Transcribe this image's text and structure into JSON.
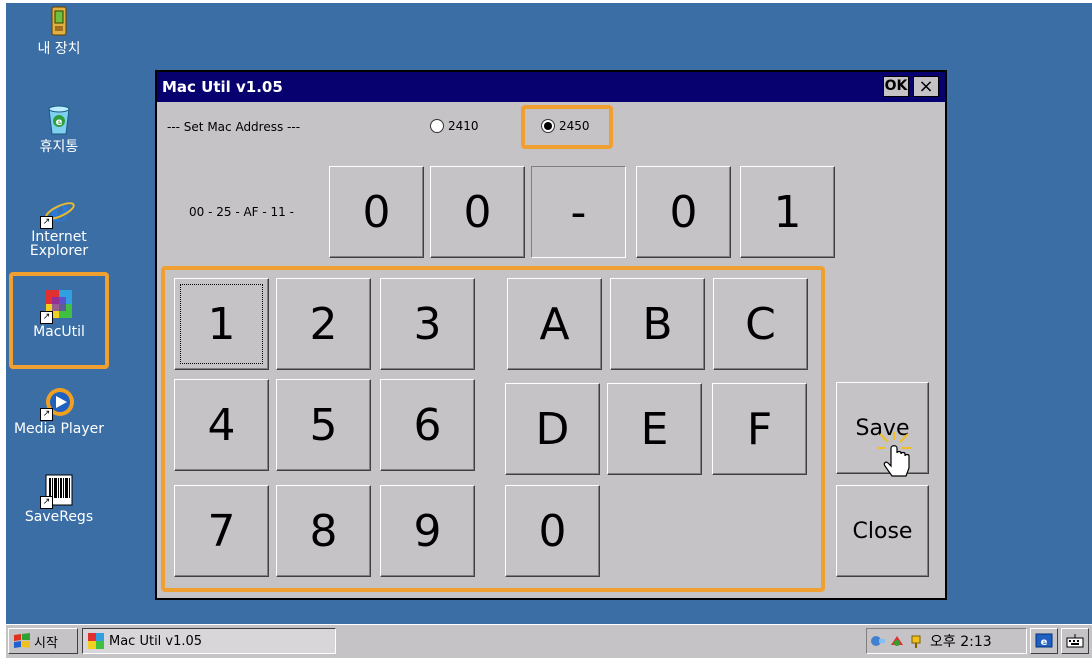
{
  "desktop": {
    "icons": [
      {
        "label": "내 장치"
      },
      {
        "label": "휴지통"
      },
      {
        "label": "Internet Explorer"
      },
      {
        "label": "MacUtil"
      },
      {
        "label": "Media Player"
      },
      {
        "label": "SaveRegs"
      }
    ]
  },
  "window": {
    "title": "Mac Util v1.05",
    "ok_label": "OK",
    "close_label": "×",
    "section_label": "--- Set Mac Address ---",
    "radio_2410": "2410",
    "radio_2450": "2450",
    "selected_band": "2450",
    "mac_prefix": "00 - 25 - AF - 11 -",
    "mac_digits": [
      "0",
      "0",
      "-",
      "0",
      "1"
    ],
    "keypad": {
      "row1": [
        "1",
        "2",
        "3",
        "A",
        "B",
        "C"
      ],
      "row2": [
        "4",
        "5",
        "6",
        "D",
        "E",
        "F"
      ],
      "row3": [
        "7",
        "8",
        "9",
        "0"
      ]
    },
    "save_label": "Save",
    "close_button_label": "Close"
  },
  "taskbar": {
    "start_label": "시작",
    "task_label": "Mac Util v1.05",
    "clock": "오후 2:13"
  },
  "colors": {
    "desktop": "#3a6ea5",
    "titlebar": "#07006f",
    "highlight": "#f0a030",
    "window_bg": "#c6c3c6"
  }
}
